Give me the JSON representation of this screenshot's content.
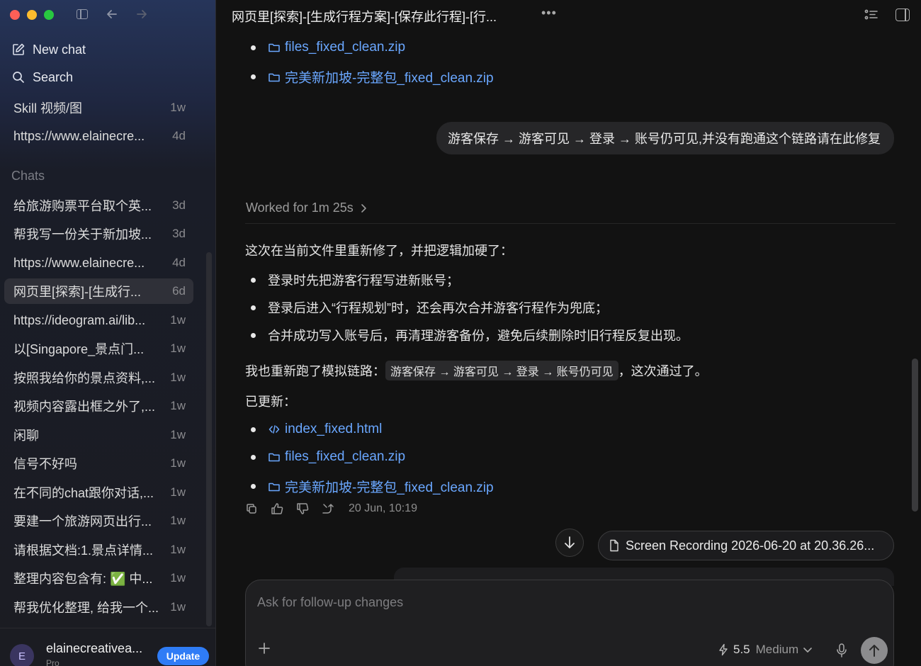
{
  "sidebar": {
    "new_chat": "New chat",
    "search": "Search",
    "pinned": [
      {
        "title": "Skill 视频/图",
        "age": "1w"
      },
      {
        "title": "https://www.elainecre...",
        "age": "4d"
      }
    ],
    "section_label": "Chats",
    "chats": [
      {
        "title": "给旅游购票平台取个英...",
        "age": "3d"
      },
      {
        "title": "帮我写一份关于新加坡...",
        "age": "3d"
      },
      {
        "title": "https://www.elainecre...",
        "age": "4d"
      },
      {
        "title": "网页里[探索]-[生成行...",
        "age": "6d"
      },
      {
        "title": "https://ideogram.ai/lib...",
        "age": "1w"
      },
      {
        "title": "以[Singapore_景点门...",
        "age": "1w"
      },
      {
        "title": "按照我给你的景点资料,...",
        "age": "1w"
      },
      {
        "title": "视频内容露出框之外了,...",
        "age": "1w"
      },
      {
        "title": "闲聊",
        "age": "1w"
      },
      {
        "title": "信号不好吗",
        "age": "1w"
      },
      {
        "title": "在不同的chat跟你对话,...",
        "age": "1w"
      },
      {
        "title": "要建一个旅游网页出行...",
        "age": "1w"
      },
      {
        "title": "请根据文档:1.景点详情...",
        "age": "1w"
      },
      {
        "title": "整理内容包含有: ✅ 中...",
        "age": "1w"
      },
      {
        "title": "帮我优化整理, 给我一个...",
        "age": "1w"
      }
    ],
    "profile": {
      "avatar_letter": "E",
      "name": "elainecreativea...",
      "plan": "Pro",
      "update_label": "Update"
    }
  },
  "header": {
    "title": "网页里[探索]-[生成行程方案]-[保存此行程]-[行...",
    "more": "•••"
  },
  "messages": {
    "top_links": [
      "files_fixed_clean.zip",
      "完美新加坡-完整包_fixed_clean.zip"
    ],
    "user_message": "游客保存 → 游客可见 → 登录 → 账号仍可见,并没有跑通这个链路请在此修复",
    "worked_for": "Worked for 1m 25s",
    "intro": "这次在当前文件里重新修了，并把逻辑加硬了：",
    "bullets": [
      "登录时先把游客行程写进新账号；",
      "登录后进入“行程规划”时，还会再次合并游客行程作为兜底；",
      "合并成功写入账号后，再清理游客备份，避免后续删除时旧行程反复出现。"
    ],
    "rerun_prefix": "我也重新跑了模拟链路：",
    "rerun_code": "游客保存 → 游客可见 → 登录 → 账号仍可见",
    "rerun_suffix": "，这次通过了。",
    "updated_label": "已更新：",
    "updated_files": [
      "index_fixed.html",
      "files_fixed_clean.zip",
      "完美新加坡-完整包_fixed_clean.zip"
    ],
    "timestamp": "20 Jun, 10:19"
  },
  "attachment": {
    "name": "Screen Recording 2026-06-20 at 20.36.26..."
  },
  "composer": {
    "placeholder": "Ask for follow-up changes",
    "model": "5.5",
    "level": "Medium"
  }
}
